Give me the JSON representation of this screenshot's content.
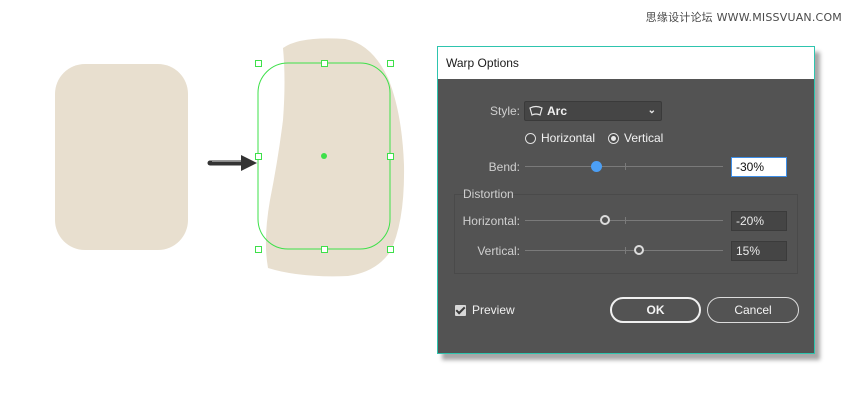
{
  "watermark": "思缘设计论坛 WWW.MISSVUAN.COM",
  "colors": {
    "shape_fill": "#e8dfcf",
    "selection_green": "#3ee04a",
    "dialog_bg": "#535353",
    "accent_blue": "#4c9ff5",
    "dialog_border": "#2ec4ae"
  },
  "dialog": {
    "title": "Warp Options",
    "style": {
      "label": "Style:",
      "value": "Arc",
      "icon": "arc-icon"
    },
    "orientation": {
      "horizontal_label": "Horizontal",
      "vertical_label": "Vertical",
      "selected": "Vertical"
    },
    "bend": {
      "label": "Bend:",
      "value": "-30%",
      "percent": -30
    },
    "distortion": {
      "title": "Distortion",
      "horizontal": {
        "label": "Horizontal:",
        "value": "-20%",
        "percent": -20
      },
      "vertical": {
        "label": "Vertical:",
        "value": "15%",
        "percent": 15
      }
    },
    "preview": {
      "label": "Preview",
      "checked": true
    },
    "ok_label": "OK",
    "cancel_label": "Cancel"
  }
}
